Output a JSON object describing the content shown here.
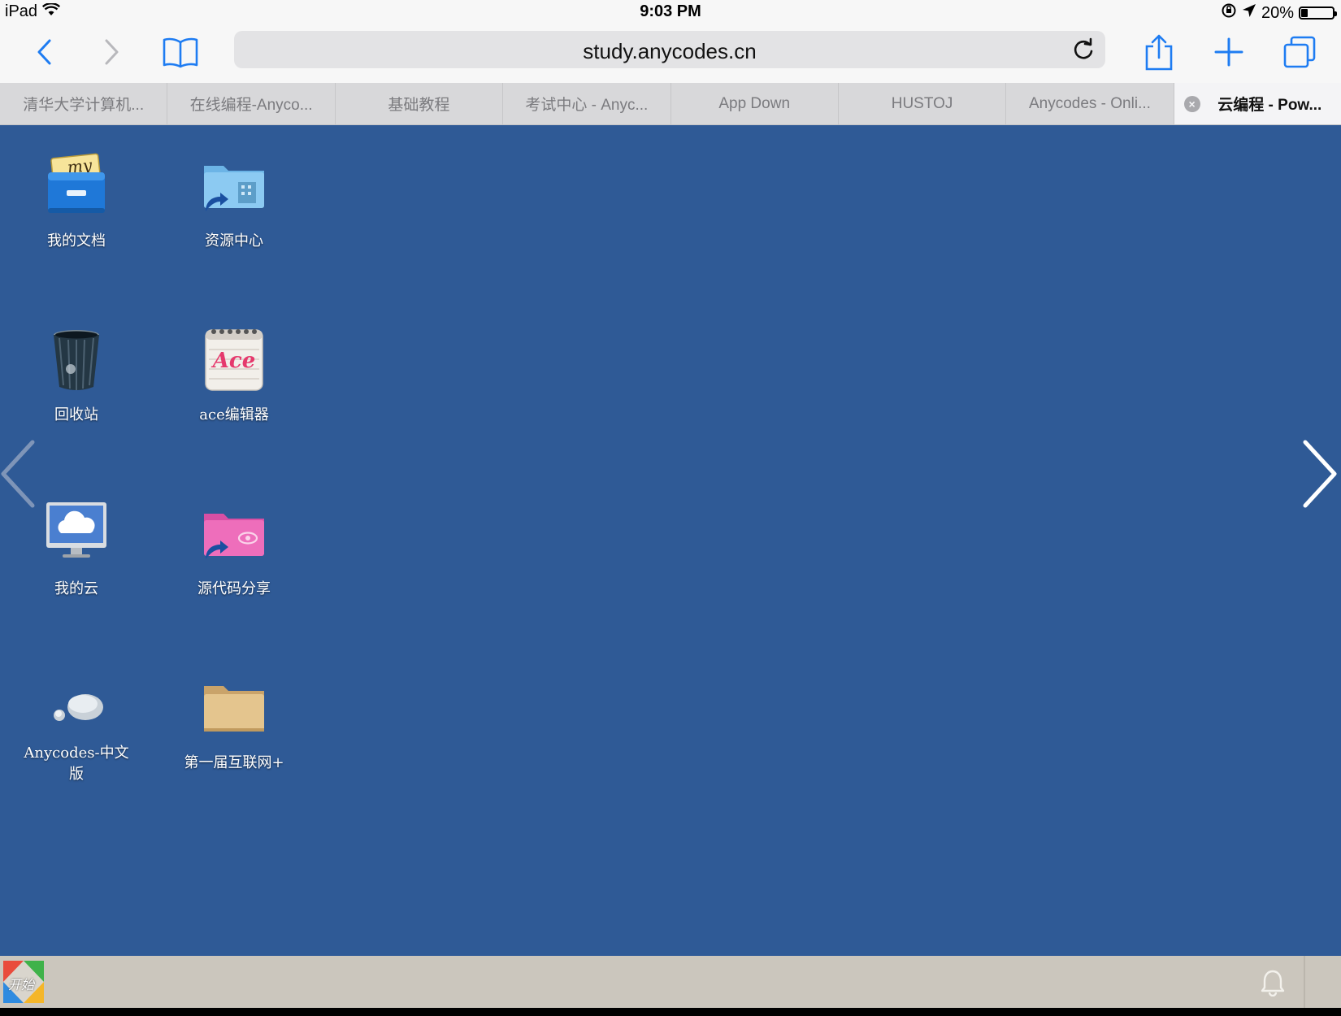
{
  "status_bar": {
    "device": "iPad",
    "time": "9:03 PM",
    "battery": "20%",
    "battery_level": 0.2,
    "icons": [
      "wifi-icon",
      "orientation-lock-icon",
      "location-arrow-icon",
      "battery-icon"
    ]
  },
  "toolbar": {
    "url": "study.anycodes.cn",
    "icons": [
      "back-icon",
      "forward-icon",
      "bookmarks-icon",
      "reload-icon",
      "share-icon",
      "new-tab-icon",
      "tabs-icon"
    ]
  },
  "tabs": [
    {
      "label": "清华大学计算机..."
    },
    {
      "label": "在线编程-Anyco..."
    },
    {
      "label": "基础教程"
    },
    {
      "label": "考试中心 - Anyc..."
    },
    {
      "label": "App Down"
    },
    {
      "label": "HUSTOJ"
    },
    {
      "label": "Anycodes - Onli..."
    },
    {
      "label": "云编程 - Pow...",
      "active": true,
      "close": "×"
    }
  ],
  "desktop": {
    "icons": [
      {
        "label": "我的文档",
        "icon": "my-documents-cabinet-icon",
        "badge": "my"
      },
      {
        "label": "资源中心",
        "icon": "resource-folder-icon"
      },
      {
        "label": "回收站",
        "icon": "trash-icon"
      },
      {
        "label": "ace编辑器",
        "icon": "ace-notepad-icon",
        "badge": "Ace"
      },
      {
        "label": "我的云",
        "icon": "cloud-monitor-icon"
      },
      {
        "label": "源代码分享",
        "icon": "shared-folder-icon"
      },
      {
        "label": "Anycodes-中文版",
        "icon": "speech-bubble-icon"
      },
      {
        "label": "第一届互联网+",
        "icon": "folder-icon"
      }
    ],
    "prev_page_icon": "chevron-left-icon",
    "next_page_icon": "chevron-right-icon"
  },
  "taskbar": {
    "start_label": "开始",
    "notification_icon": "bell-icon"
  },
  "colors": {
    "desktop_bg": "#2f5a96",
    "toolbar_bg": "#f7f7f7",
    "tint": "#1e7cf2",
    "taskbar_bg": "#cbc6bd"
  }
}
